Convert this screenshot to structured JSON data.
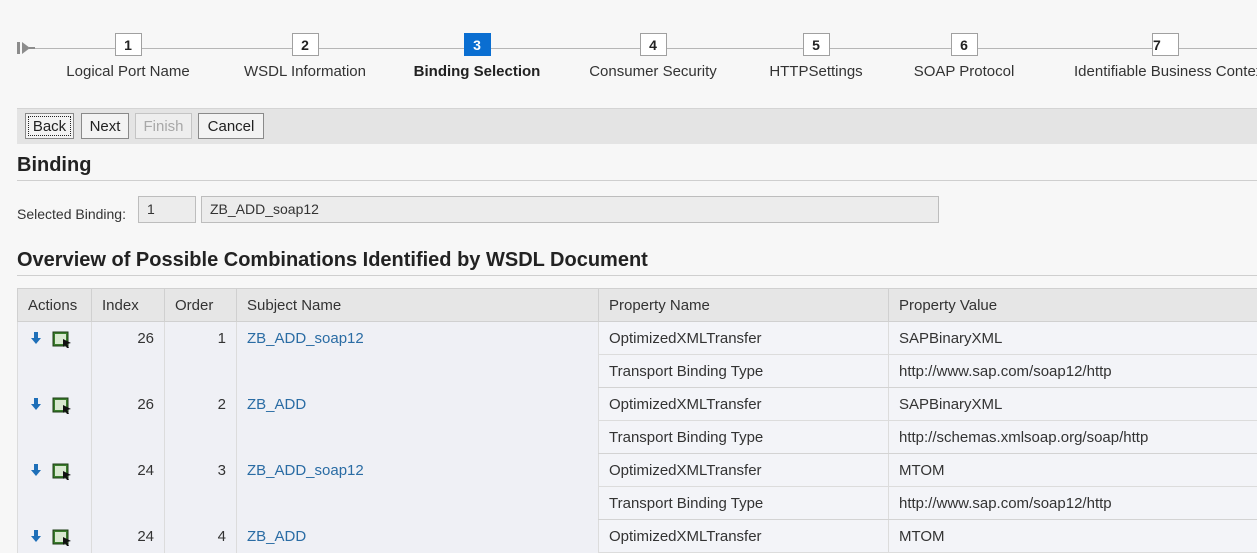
{
  "roadmap": {
    "steps": [
      {
        "number": "1",
        "label": "Logical Port Name"
      },
      {
        "number": "2",
        "label": "WSDL Information"
      },
      {
        "number": "3",
        "label": "Binding Selection"
      },
      {
        "number": "4",
        "label": "Consumer Security"
      },
      {
        "number": "5",
        "label": "HTTPSettings"
      },
      {
        "number": "6",
        "label": "SOAP Protocol"
      },
      {
        "number": "7",
        "label": "Identifiable Business Context"
      }
    ],
    "active_step": "3",
    "colors": {
      "active": "#0a6ed1"
    }
  },
  "toolbar": {
    "back_label": "Back",
    "next_label": "Next",
    "finish_label": "Finish",
    "cancel_label": "Cancel"
  },
  "binding": {
    "title": "Binding",
    "selected_label": "Selected Binding:",
    "selected_number": "1",
    "selected_name": "ZB_ADD_soap12"
  },
  "overview": {
    "title": "Overview of Possible Combinations Identified by WSDL Document",
    "columns": {
      "actions": "Actions",
      "index": "Index",
      "order": "Order",
      "subject": "Subject Name",
      "property_name": "Property Name",
      "property_value": "Property Value"
    },
    "rows": [
      {
        "index": "26",
        "order": "1",
        "subject": "ZB_ADD_soap12",
        "prop1_name": "OptimizedXMLTransfer",
        "prop1_value": "SAPBinaryXML",
        "prop2_name": "Transport Binding Type",
        "prop2_value": "http://www.sap.com/soap12/http"
      },
      {
        "index": "26",
        "order": "2",
        "subject": "ZB_ADD",
        "prop1_name": "OptimizedXMLTransfer",
        "prop1_value": "SAPBinaryXML",
        "prop2_name": "Transport Binding Type",
        "prop2_value": "http://schemas.xmlsoap.org/soap/http"
      },
      {
        "index": "24",
        "order": "3",
        "subject": "ZB_ADD_soap12",
        "prop1_name": "OptimizedXMLTransfer",
        "prop1_value": "MTOM",
        "prop2_name": "Transport Binding Type",
        "prop2_value": "http://www.sap.com/soap12/http"
      },
      {
        "index": "24",
        "order": "4",
        "subject": "ZB_ADD",
        "prop1_name": "OptimizedXMLTransfer",
        "prop1_value": "MTOM"
      }
    ],
    "icons": {
      "action_1": "arrow-down-icon",
      "action_2": "select-binding-icon"
    }
  }
}
